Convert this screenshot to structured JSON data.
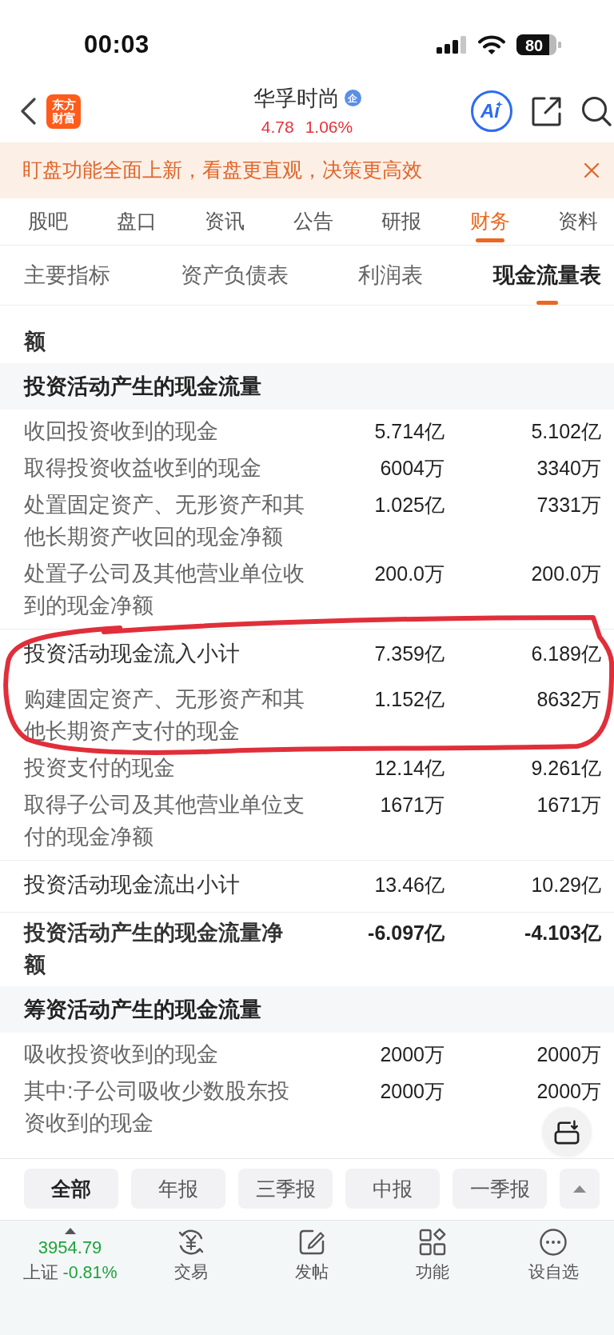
{
  "status_bar": {
    "time": "00:03",
    "battery": "80"
  },
  "header": {
    "logo": "东方财富",
    "title": "华孚时尚",
    "badge": "企",
    "price": "4.78",
    "change": "1.06%",
    "ai_button": "Ai"
  },
  "banner": {
    "text": "盯盘功能全面上新，看盘更直观，决策更高效"
  },
  "tabs": [
    {
      "label": "股吧",
      "selected": false
    },
    {
      "label": "盘口",
      "selected": false
    },
    {
      "label": "资讯",
      "selected": false
    },
    {
      "label": "公告",
      "selected": false
    },
    {
      "label": "研报",
      "selected": false
    },
    {
      "label": "财务",
      "selected": true
    },
    {
      "label": "资料",
      "selected": false
    }
  ],
  "sub_tabs": [
    {
      "label": "主要指标",
      "selected": false
    },
    {
      "label": "资产负债表",
      "selected": false
    },
    {
      "label": "利润表",
      "selected": false
    },
    {
      "label": "现金流量表",
      "selected": true
    }
  ],
  "table": {
    "rows": [
      {
        "kind": "total",
        "label": "额",
        "circled": false
      },
      {
        "kind": "section",
        "label": "投资活动产生的现金流量",
        "circled": false
      },
      {
        "kind": "item",
        "label": "收回投资收到的现金",
        "values": [
          "5.714亿",
          "5.102亿"
        ],
        "circled": false
      },
      {
        "kind": "item",
        "label": "取得投资收益收到的现金",
        "values": [
          "6004万",
          "3340万"
        ],
        "circled": false
      },
      {
        "kind": "item",
        "label": "处置固定资产、无形资产和其他长期资产收回的现金净额",
        "values": [
          "1.025亿",
          "7331万"
        ],
        "circled": false
      },
      {
        "kind": "item",
        "label": "处置子公司及其他营业单位收到的现金净额",
        "values": [
          "200.0万",
          "200.0万"
        ],
        "circled": false
      },
      {
        "kind": "subtotal",
        "label": "投资活动现金流入小计",
        "values": [
          "7.359亿",
          "6.189亿"
        ],
        "circled": true
      },
      {
        "kind": "item",
        "label": "购建固定资产、无形资产和其他长期资产支付的现金",
        "values": [
          "1.152亿",
          "8632万"
        ],
        "circled": true
      },
      {
        "kind": "item",
        "label": "投资支付的现金",
        "values": [
          "12.14亿",
          "9.261亿"
        ],
        "circled": false
      },
      {
        "kind": "item",
        "label": "取得子公司及其他营业单位支付的现金净额",
        "values": [
          "1671万",
          "1671万"
        ],
        "circled": false
      },
      {
        "kind": "subtotal",
        "label": "投资活动现金流出小计",
        "values": [
          "13.46亿",
          "10.29亿"
        ],
        "circled": false
      },
      {
        "kind": "total",
        "label": "投资活动产生的现金流量净额",
        "values": [
          "-6.097亿",
          "-4.103亿"
        ],
        "circled": false
      },
      {
        "kind": "section",
        "label": "筹资活动产生的现金流量",
        "circled": false
      },
      {
        "kind": "item",
        "label": "吸收投资收到的现金",
        "values": [
          "2000万",
          "2000万"
        ],
        "circled": false
      },
      {
        "kind": "item",
        "label": "其中:子公司吸收少数股东投资收到的现金",
        "values": [
          "2000万",
          "2000万"
        ],
        "circled": false
      }
    ]
  },
  "period_filters": [
    {
      "label": "全部",
      "selected": true
    },
    {
      "label": "年报",
      "selected": false
    },
    {
      "label": "三季报",
      "selected": false
    },
    {
      "label": "中报",
      "selected": false
    },
    {
      "label": "一季报",
      "selected": false
    }
  ],
  "market_index": {
    "value": "3954.79",
    "name": "上证",
    "change": "-0.81%"
  },
  "nav_items": [
    {
      "kind": "trade",
      "label": "交易"
    },
    {
      "kind": "post",
      "label": "发帖"
    },
    {
      "kind": "functions",
      "label": "功能"
    },
    {
      "kind": "watchlist",
      "label": "设自选"
    }
  ]
}
